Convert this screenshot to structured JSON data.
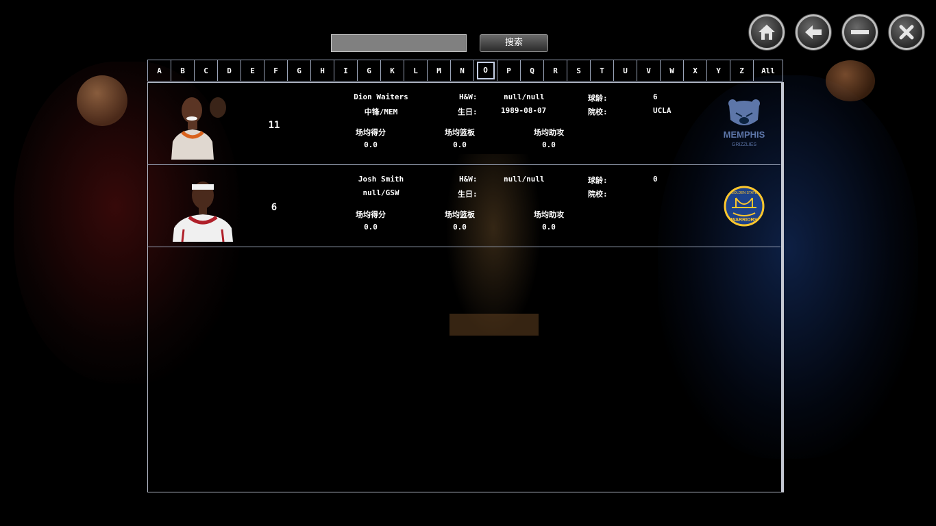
{
  "search": {
    "value": "",
    "button_label": "搜索"
  },
  "alphabet": {
    "letters": [
      "A",
      "B",
      "C",
      "D",
      "E",
      "F",
      "G",
      "H",
      "I",
      "G",
      "K",
      "L",
      "M",
      "N",
      "O",
      "P",
      "Q",
      "R",
      "S",
      "T",
      "U",
      "V",
      "W",
      "X",
      "Y",
      "Z"
    ],
    "all_label": "All",
    "selected": "O"
  },
  "players": [
    {
      "number": "11",
      "name": "Dion Waiters",
      "position_team": "中锋/MEM",
      "hw_label": "H&W:",
      "hw_value": "null/null",
      "age_label": "球龄:",
      "age_value": "6",
      "birth_label": "生日:",
      "birth_value": "1989-08-07",
      "school_label": "院校:",
      "school_value": "UCLA",
      "points_label": "场均得分",
      "points_value": "0.0",
      "rebounds_label": "场均篮板",
      "rebounds_value": "0.0",
      "assists_label": "场均助攻",
      "assists_value": "0.0",
      "team_logo": "memphis-grizzlies-logo",
      "logo_text": "MEMPHIS",
      "logo_subtext": "GRIZZLIES",
      "jersey_color": "#e8e0d8"
    },
    {
      "number": "6",
      "name": "Josh Smith",
      "position_team": "null/GSW",
      "hw_label": "H&W:",
      "hw_value": "null/null",
      "age_label": "球龄:",
      "age_value": "0",
      "birth_label": "生日:",
      "birth_value": "",
      "school_label": "院校:",
      "school_value": "",
      "points_label": "场均得分",
      "points_value": "0.0",
      "rebounds_label": "场均篮板",
      "rebounds_value": "0.0",
      "assists_label": "场均助攻",
      "assists_value": "0.0",
      "team_logo": "golden-state-warriors-logo",
      "logo_text": "GOLDEN STATE",
      "logo_subtext": "WARRIORS",
      "jersey_color": "#f0f0f0"
    }
  ],
  "window_controls": [
    "home-icon",
    "back-arrow-icon",
    "minimize-icon",
    "close-icon"
  ],
  "colors": {
    "accent_border": "#9aa4b8",
    "memphis_blue": "#5d76a9",
    "warriors_blue": "#1d428a",
    "warriors_gold": "#ffc72c"
  }
}
